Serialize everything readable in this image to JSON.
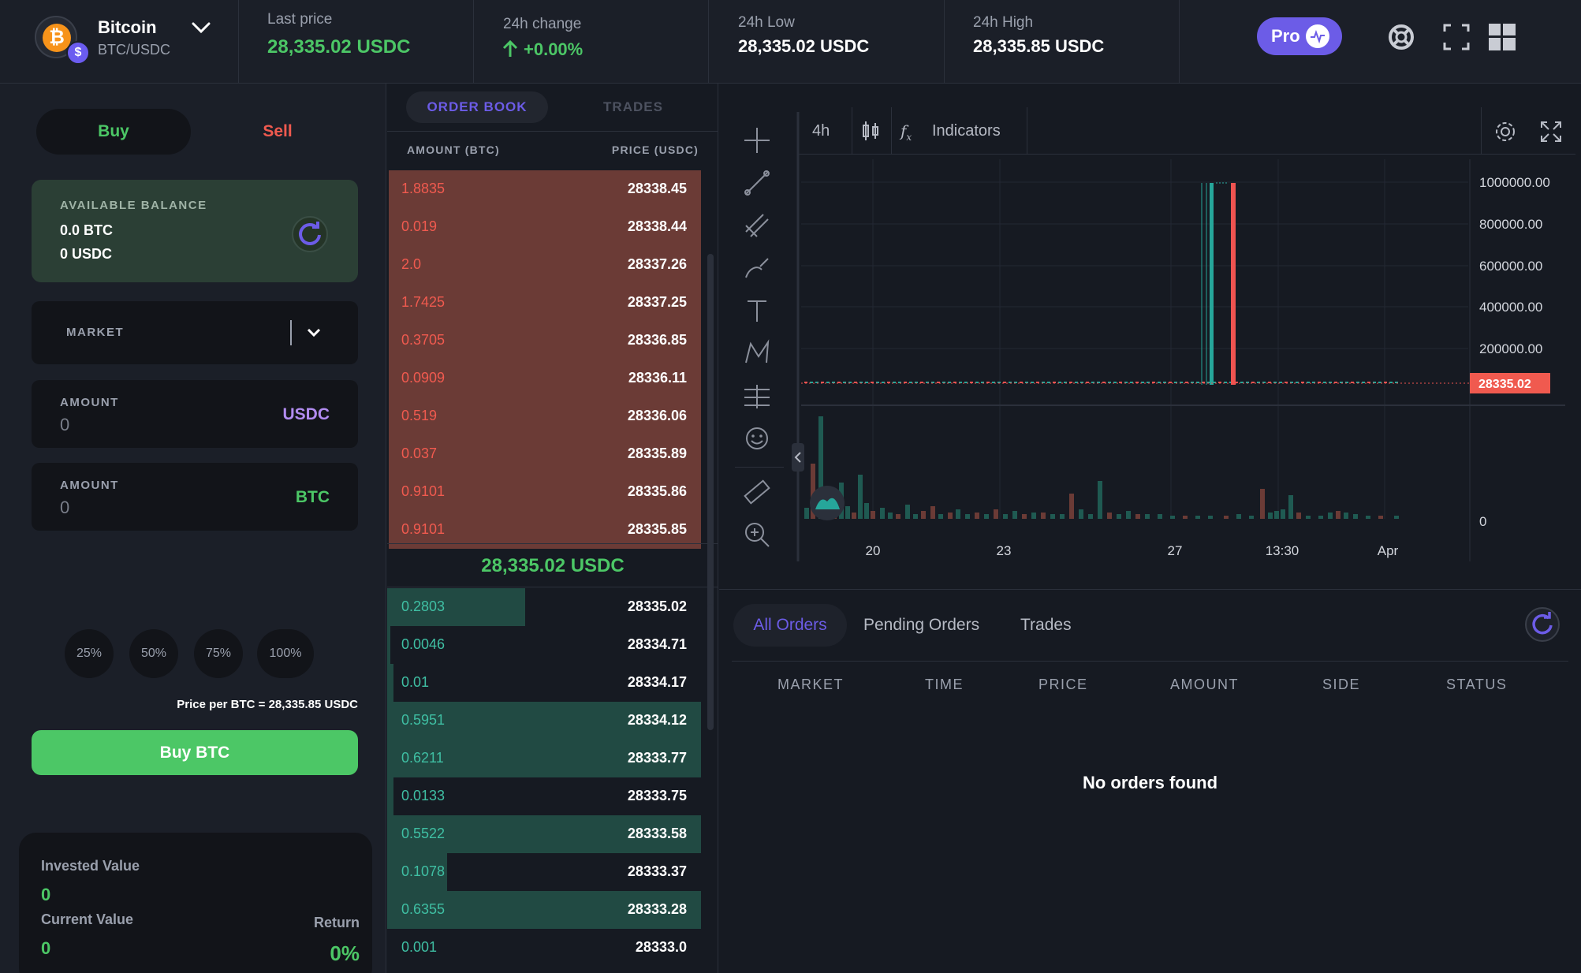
{
  "header": {
    "coin_name": "Bitcoin",
    "coin_pair": "BTC/USDC",
    "stats": [
      {
        "label": "Last price",
        "value": "28,335.02 USDC"
      },
      {
        "label": "24h change",
        "value": "+0.00%"
      },
      {
        "label": "24h Low",
        "value": "28,335.02 USDC"
      },
      {
        "label": "24h High",
        "value": "28,335.85 USDC"
      }
    ],
    "pro_label": "Pro",
    "icons": [
      "support-icon",
      "fullscreen-icon",
      "layout-icon"
    ]
  },
  "trade": {
    "buy_label": "Buy",
    "sell_label": "Sell",
    "balance_label": "AVAILABLE BALANCE",
    "balance_btc": "0.0 BTC",
    "balance_usdc": "0 USDC",
    "order_type": "MARKET",
    "amount_label": "AMOUNT",
    "amount_usdc_value": "0",
    "amount_usdc_unit": "USDC",
    "amount_btc_value": "0",
    "amount_btc_unit": "BTC",
    "percents": [
      "25%",
      "50%",
      "75%",
      "100%"
    ],
    "price_per": "Price per BTC = 28,335.85 USDC",
    "cta": "Buy BTC",
    "invested_label": "Invested Value",
    "invested_value": "0",
    "current_label": "Current Value",
    "current_value": "0",
    "return_label": "Return",
    "return_value": "0%"
  },
  "orderbook": {
    "tabs": [
      "ORDER BOOK",
      "TRADES"
    ],
    "col_amount": "AMOUNT (BTC)",
    "col_price": "PRICE (USDC)",
    "mid_price": "28,335.02 USDC",
    "asks": [
      {
        "amount": "1.8835",
        "price": "28338.45",
        "depth": 1.0
      },
      {
        "amount": "0.019",
        "price": "28338.44",
        "depth": 1.0
      },
      {
        "amount": "2.0",
        "price": "28337.26",
        "depth": 1.0
      },
      {
        "amount": "1.7425",
        "price": "28337.25",
        "depth": 1.0
      },
      {
        "amount": "0.3705",
        "price": "28336.85",
        "depth": 1.0
      },
      {
        "amount": "0.0909",
        "price": "28336.11",
        "depth": 1.0
      },
      {
        "amount": "0.519",
        "price": "28336.06",
        "depth": 1.0
      },
      {
        "amount": "0.037",
        "price": "28335.89",
        "depth": 1.0
      },
      {
        "amount": "0.9101",
        "price": "28335.86",
        "depth": 1.0
      },
      {
        "amount": "0.9101",
        "price": "28335.85",
        "depth": 1.0
      }
    ],
    "bids": [
      {
        "amount": "0.2803",
        "price": "28335.02",
        "depth": 0.44
      },
      {
        "amount": "0.0046",
        "price": "28334.71",
        "depth": 0.01
      },
      {
        "amount": "0.01",
        "price": "28334.17",
        "depth": 0.02
      },
      {
        "amount": "0.5951",
        "price": "28334.12",
        "depth": 1.0
      },
      {
        "amount": "0.6211",
        "price": "28333.77",
        "depth": 1.0
      },
      {
        "amount": "0.0133",
        "price": "28333.75",
        "depth": 0.02
      },
      {
        "amount": "0.5522",
        "price": "28333.58",
        "depth": 1.0
      },
      {
        "amount": "0.1078",
        "price": "28333.37",
        "depth": 0.19
      },
      {
        "amount": "0.6355",
        "price": "28333.28",
        "depth": 1.0
      },
      {
        "amount": "0.001",
        "price": "28333.0",
        "depth": 0.0
      }
    ]
  },
  "chart": {
    "interval": "4h",
    "indicators_label": "Indicators",
    "price_tag": "28335.02",
    "colors": {
      "up": "#26a69a",
      "down": "#ef5350",
      "bg": "#161a22",
      "grid": "#232833"
    }
  },
  "chart_data": {
    "type": "candlestick",
    "x_ticks": [
      "20",
      "23",
      "27",
      "13:30",
      "Apr"
    ],
    "y_ticks": [
      "1000000.00",
      "800000.00",
      "600000.00",
      "400000.00",
      "200000.00",
      "0"
    ],
    "last_price": 28335.02
  },
  "orders": {
    "tabs": [
      "All Orders",
      "Pending Orders",
      "Trades"
    ],
    "columns": [
      "MARKET",
      "TIME",
      "PRICE",
      "AMOUNT",
      "SIDE",
      "STATUS"
    ],
    "empty_text": "No orders found"
  }
}
